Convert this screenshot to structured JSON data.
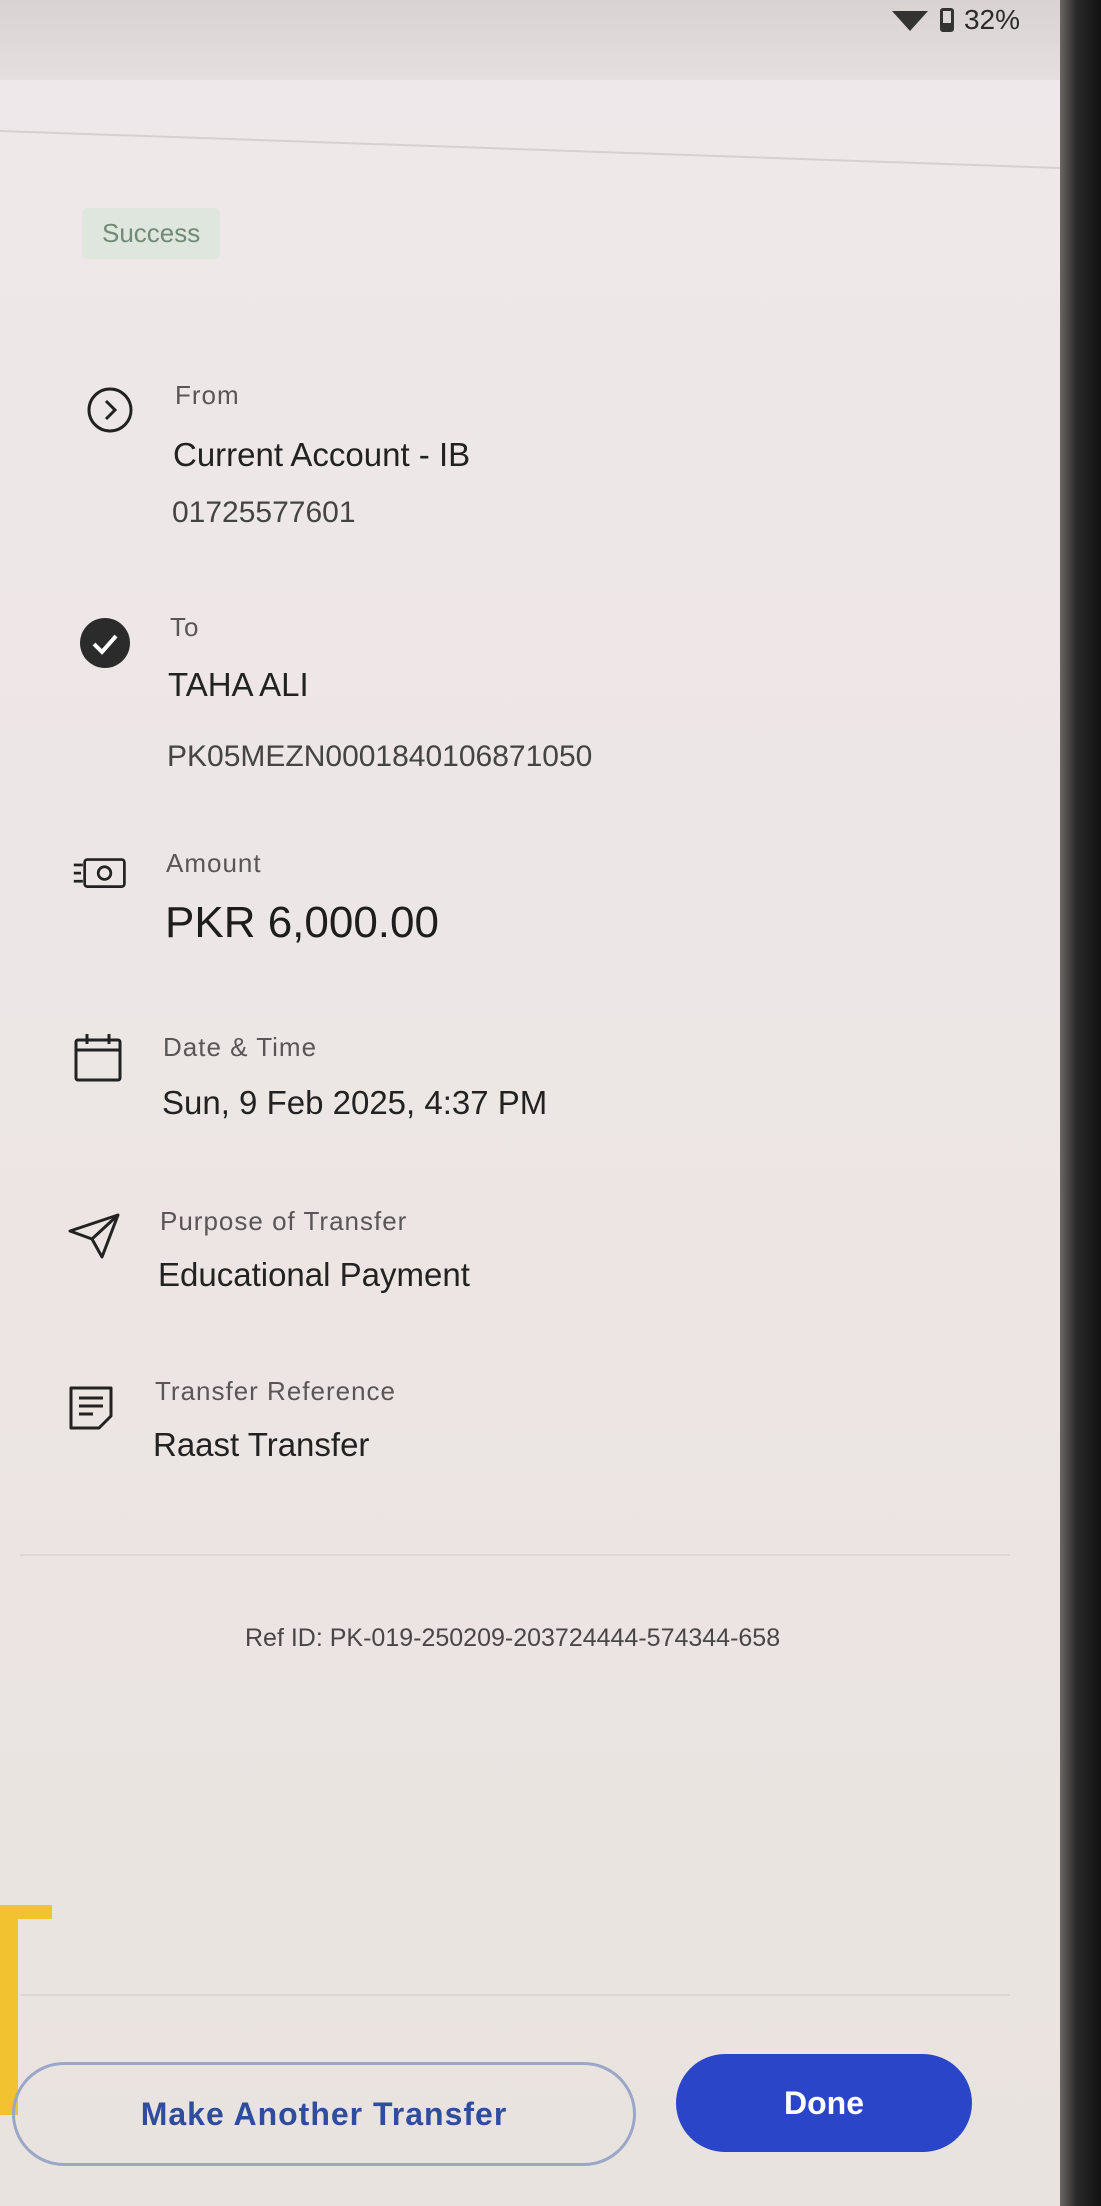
{
  "status_bar": {
    "battery": "32%"
  },
  "badge": "Success",
  "from": {
    "label": "From",
    "account_name": "Current Account - IB",
    "account_number": "01725577601"
  },
  "to": {
    "label": "To",
    "name": "TAHA ALI",
    "iban": "PK05MEZN0001840106871050"
  },
  "amount": {
    "label": "Amount",
    "value": "PKR 6,000.00"
  },
  "datetime": {
    "label": "Date & Time",
    "value": "Sun, 9 Feb 2025, 4:37 PM"
  },
  "purpose": {
    "label": "Purpose of Transfer",
    "value": "Educational Payment"
  },
  "reference": {
    "label": "Transfer Reference",
    "value": "Raast Transfer"
  },
  "ref_id": "Ref ID: PK-019-250209-203724444-574344-658",
  "buttons": {
    "secondary": "Make Another Transfer",
    "primary": "Done"
  },
  "icons": [
    "chevron-right-circle-icon",
    "check-circle-icon",
    "cash-icon",
    "calendar-icon",
    "send-icon",
    "note-icon"
  ]
}
